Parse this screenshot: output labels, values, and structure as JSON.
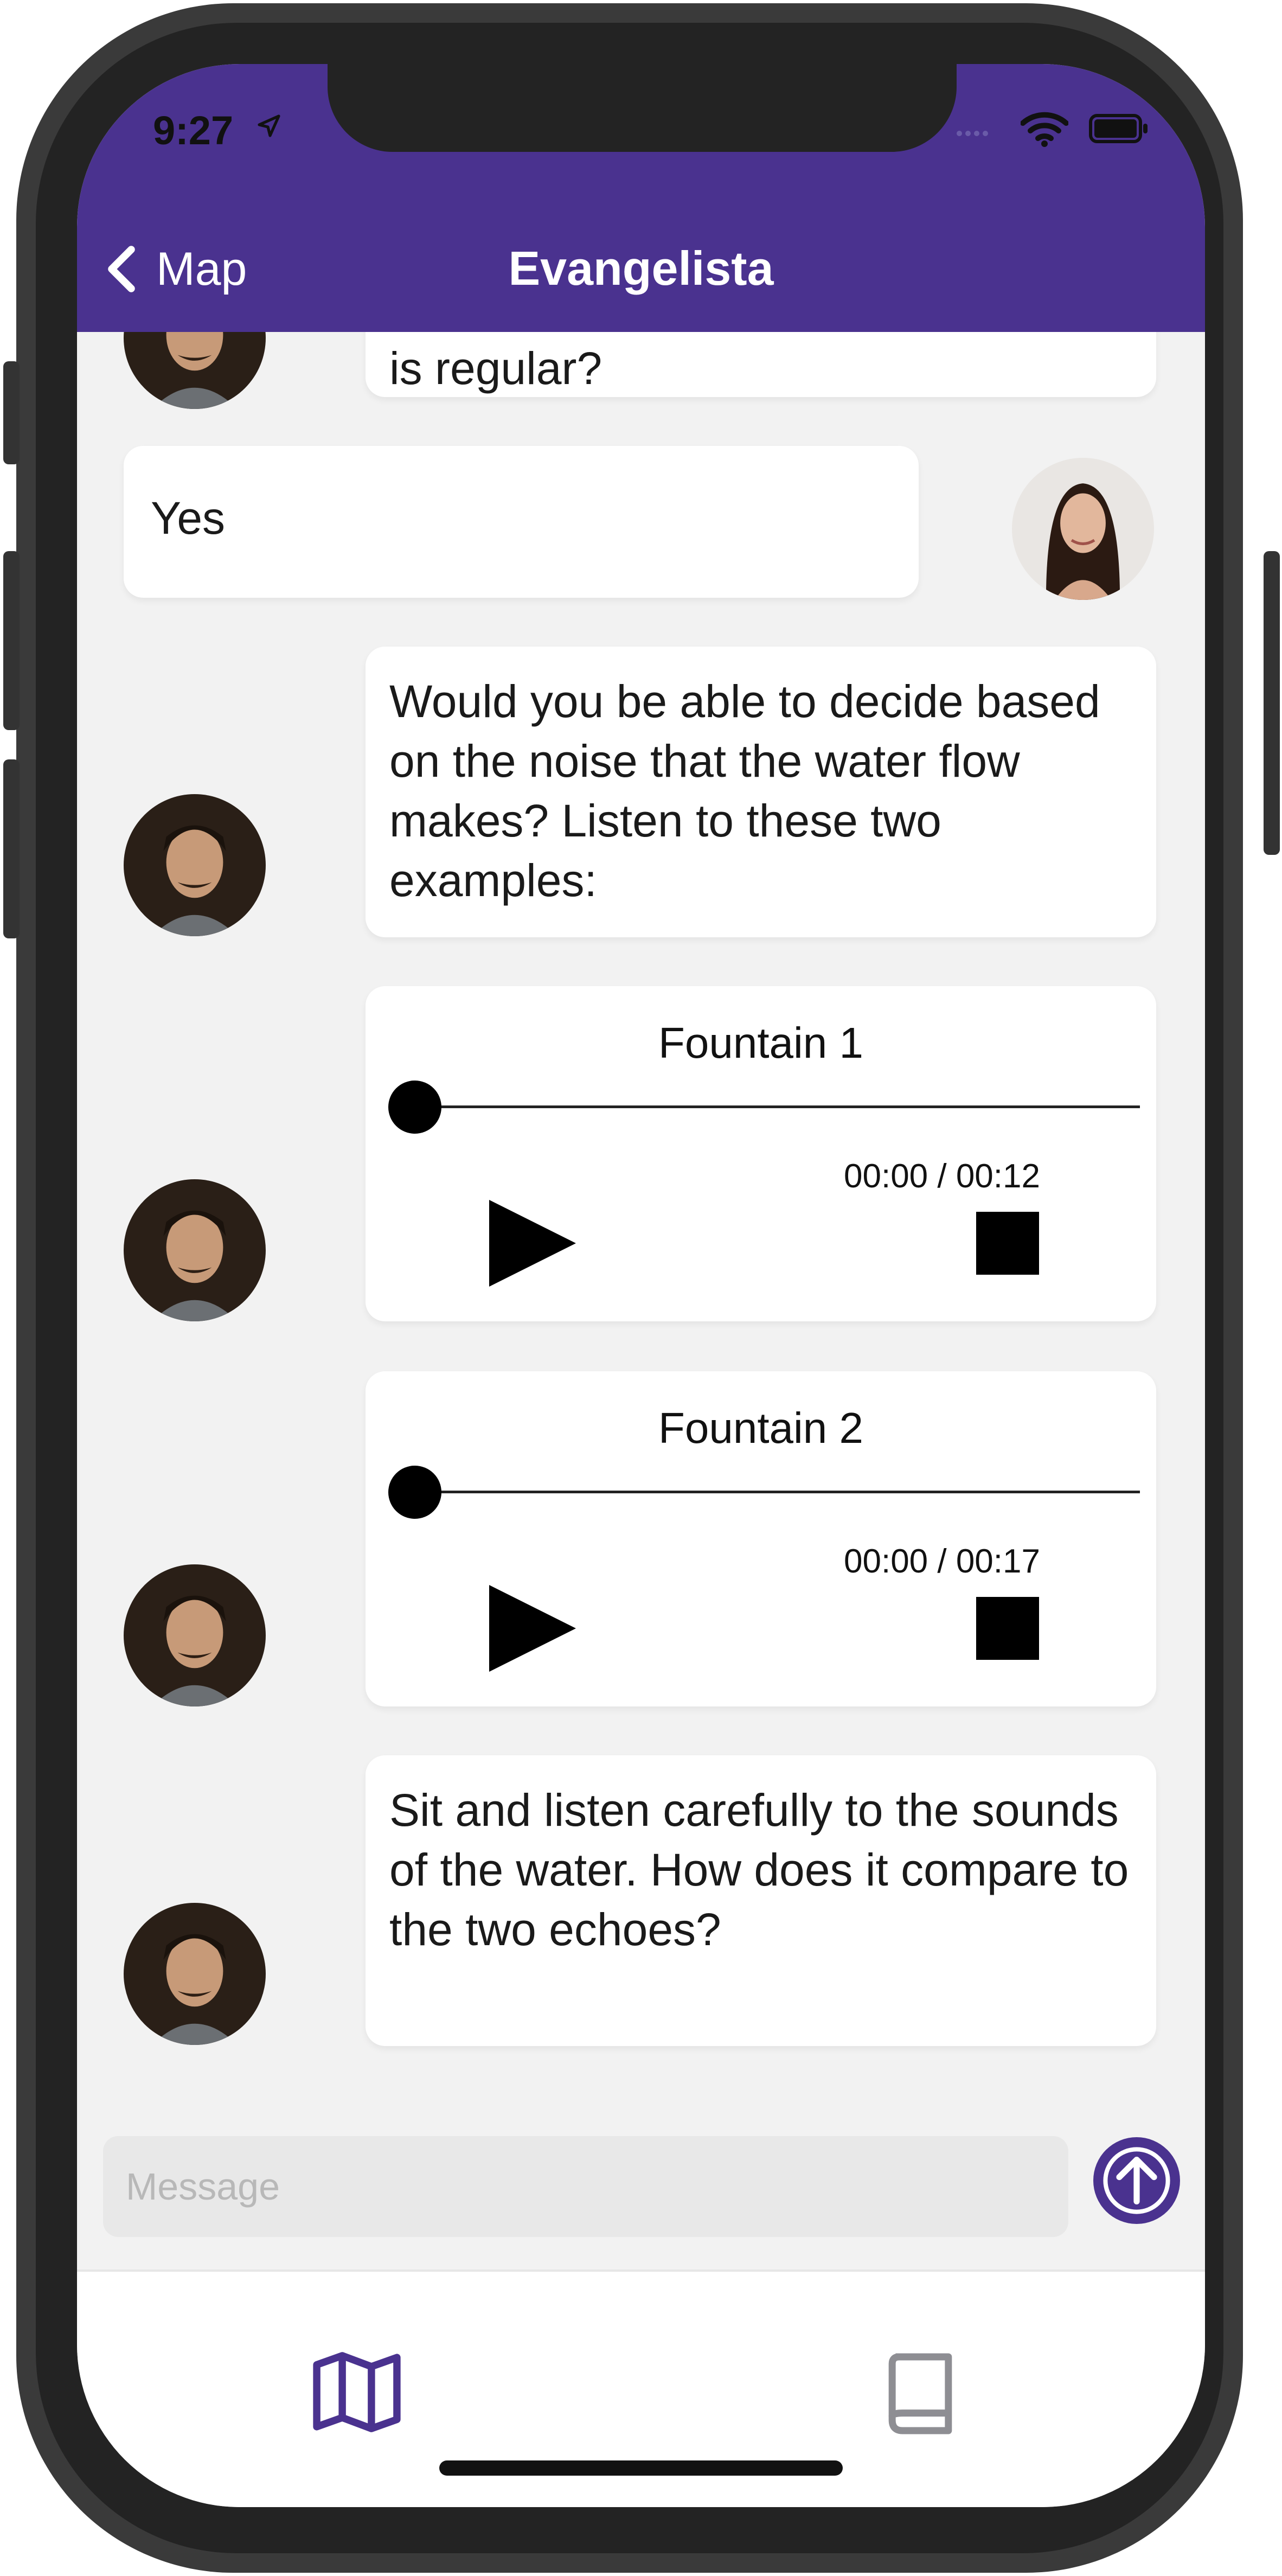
{
  "status_bar": {
    "time": "9:27"
  },
  "nav": {
    "back_label": "Map",
    "title": "Evangelista"
  },
  "messages": [
    {
      "sender": "bot",
      "text": "is regular?"
    },
    {
      "sender": "user",
      "text": "Yes"
    },
    {
      "sender": "bot",
      "text": "Would you be able to decide based on the noise that the water flow makes? Listen to these two examples:"
    },
    {
      "sender": "bot",
      "type": "audio",
      "title": "Fountain 1",
      "time": "00:00 / 00:12",
      "progress": 0
    },
    {
      "sender": "bot",
      "type": "audio",
      "title": "Fountain 2",
      "time": "00:00 / 00:17",
      "progress": 0
    },
    {
      "sender": "bot",
      "text": "Sit and listen carefully to the sounds of the water. How does it compare to the two echoes?"
    }
  ],
  "composer": {
    "placeholder": "Message"
  },
  "tabs": [
    {
      "icon": "map-icon",
      "active": true
    },
    {
      "icon": "book-icon",
      "active": false
    }
  ],
  "colors": {
    "accent": "#4a328f",
    "background": "#f2f2f2",
    "bubble": "#ffffff",
    "inactive_icon": "#8e8e93"
  }
}
